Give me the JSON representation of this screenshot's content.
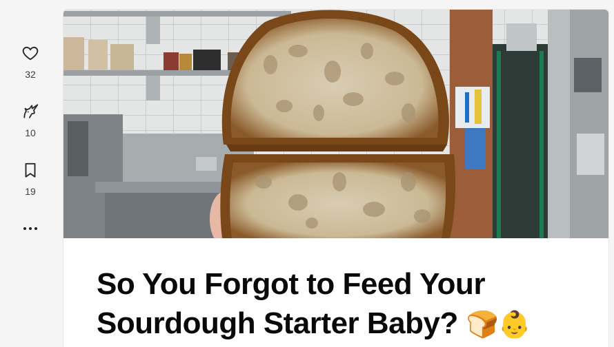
{
  "reactions": {
    "heart": {
      "icon": "heart-icon",
      "count": "32"
    },
    "unicorn": {
      "icon": "unicorn-icon",
      "count": "10"
    },
    "bookmark": {
      "icon": "bookmark-icon",
      "count": "19"
    }
  },
  "more": {
    "icon": "more-icon"
  },
  "article": {
    "title_line1": "So You Forgot to Feed Your",
    "title_line2": "Sourdough Starter Baby?",
    "title_emoji": "🍞👶"
  },
  "colors": {
    "page_bg": "#f5f5f5",
    "card_bg": "#ffffff",
    "text": "#090909",
    "muted": "#3d3d3d"
  }
}
